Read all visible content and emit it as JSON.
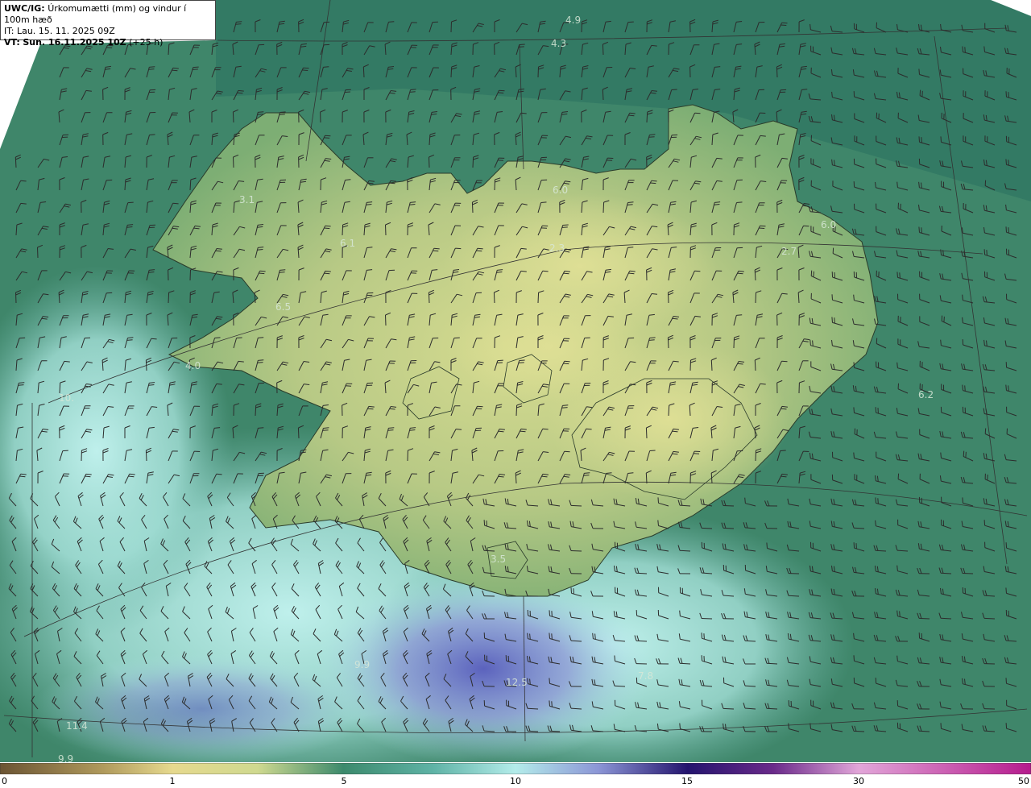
{
  "header": {
    "product": "UWC/IG:",
    "title": "Úrkomumætti (mm) og vindur í 100m hæð",
    "init_time": "IT: Lau. 15. 11. 2025 09Z",
    "valid_prefix": "VT:",
    "valid_time": "Sun. 16.11.2025 10Z",
    "lead": "(+25 h)"
  },
  "map_labels": [
    "4.9",
    "4.3",
    "3.1",
    "6.1",
    "6.5",
    "4.0",
    "10.",
    "6.0",
    "2.3",
    "6.0",
    "2.7",
    "6.2",
    "3.5",
    "9.9",
    "12.5",
    "7.8",
    "11.4",
    "9.9"
  ],
  "colorbar": {
    "ticks": [
      "0",
      "1",
      "5",
      "10",
      "15",
      "30",
      "50"
    ],
    "colors": [
      "#6b5433",
      "#cdb872",
      "#e4e192",
      "#9ab877",
      "#3b8a6d",
      "#5fb3a6",
      "#b3ecea",
      "#6a79c7",
      "#24146e",
      "#8a2b99",
      "#d06cc7",
      "#b51b8d"
    ]
  },
  "colors": {
    "land_high": "#d3d88d",
    "land_mid": "#8fbc7a",
    "ocean": "#3e8468",
    "precip_light": "#b8ecea",
    "precip_heavy": "#6f72c3"
  }
}
